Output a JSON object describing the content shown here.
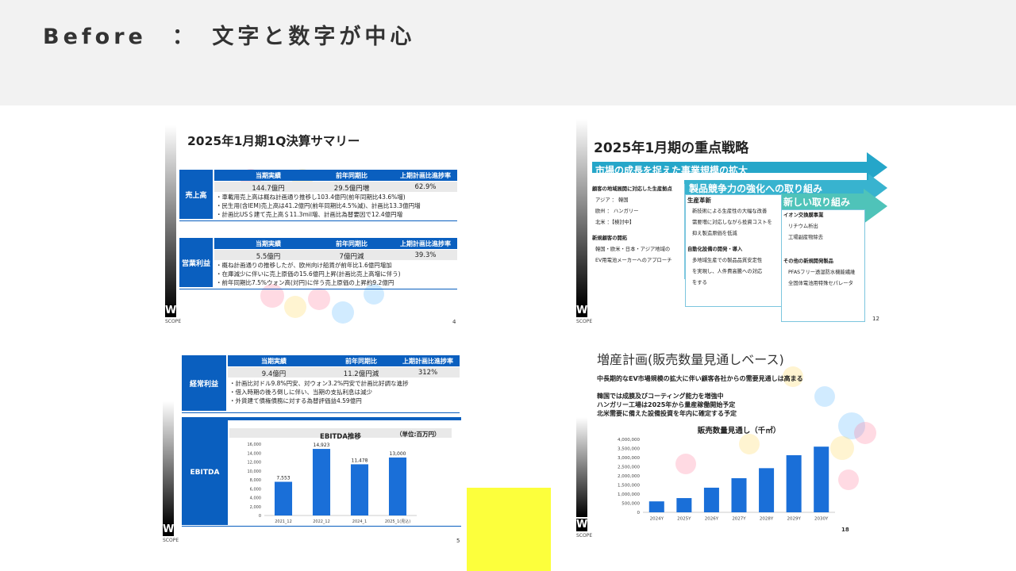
{
  "header": {
    "title": "Before　：　文字と数字が中心"
  },
  "slide_summary": {
    "title": "2025年1月期1Q決算サマリー",
    "page_number": "4",
    "logo_text": "SCOPE",
    "columns": [
      "当期実績",
      "前年同期比",
      "上期計画比進捗率"
    ],
    "sales": {
      "label": "売上高",
      "values": [
        "144.7億円",
        "29.5億円増",
        "62.9%"
      ],
      "bullets": [
        "・車載用売上高は概ね計画通り推移し103.4億円(前年同期比43.6%増)",
        "・民生用(含IEM)売上高は41.2億円(前年同期比4.5%減)、計画比13.3億円増",
        "・計画比US＄建て売上高＄11.3mil増、計画比為替要因で12.4億円増"
      ]
    },
    "op_profit": {
      "label": "営業利益",
      "values": [
        "5.5億円",
        "7億円減",
        "39.3%"
      ],
      "bullets": [
        "・概ね計画通りの推移したが、欧州向け船賃が前年比1.6億円増加",
        "・在庫減少に伴いに売上原価の15.6億円上昇(計画比売上高増に伴う)",
        "・前年同期比7.5%ウォン高(対円)に伴う売上原価の上昇約9.2億円"
      ]
    }
  },
  "slide_strategy": {
    "title": "2025年1月期の重点戦略",
    "page_number": "12",
    "logo_text": "SCOPE",
    "arrows": [
      "市場の成長を捉えた事業規模の拡大",
      "製品競争力の強化への取り組み",
      "新しい取り組み"
    ],
    "col1": {
      "heading1": "顧客の地域展開に対応した生産拠点",
      "lines1": [
        "アジア ： 韓国",
        "欧州 ： ハンガリー",
        "北米 ：【検討中】"
      ],
      "heading2": "新規顧客の開拓",
      "lines2": [
        "韓国・欧米・日本・アジア地域の",
        "EV用電池メーカーへのアプローチ"
      ]
    },
    "col2": {
      "heading1": "生産革新",
      "lines1": [
        "新技術による生産性の大幅な改善",
        "需要増に対応しながら投資コストを",
        "抑え製造原価を低減"
      ],
      "heading2": "自動化設備の開発・導入",
      "lines2": [
        "多地域生産での製品品質安定性",
        "を実現し、人件費高騰への対応",
        "をする"
      ]
    },
    "col3": {
      "heading1": "イオン交換膜事業",
      "lines1": [
        "リチウム析出",
        "工場副産物除去"
      ],
      "heading2": "その他の新規開発製品",
      "lines2": [
        "PFASフリー透湿防水機能繊維",
        "全固体電池用特殊セパレータ"
      ]
    }
  },
  "slide_ebitda": {
    "page_number": "5",
    "logo_text": "SCOPE",
    "columns": [
      "当期実績",
      "前年同期比",
      "上期計画比進捗率"
    ],
    "ordinary_profit": {
      "label": "経常利益",
      "values": [
        "9.4億円",
        "11.2億円減",
        "312%"
      ],
      "bullets": [
        "・計画比対ドル9.8%円安、対ウォン3.2%円安で計画比好調な進捗",
        "・借入時期の後ろ倒しに伴い、当期の支払利息は減少",
        "・外貨建て債権債務に対する為替評価益4.59億円"
      ]
    },
    "ebitda_label": "EBITDA",
    "unit": "（単位:百万円）"
  },
  "slide_production": {
    "title": "増産計画(販売数量見通しベース)",
    "page_number": "18",
    "logo_text": "SCOPE",
    "lines": [
      "中長期的なEV市場規模の拡大に伴い顧客各社からの需要見通しは高まる",
      "韓国では成膜及びコーティング能力を増強中",
      "ハンガリー工場は2025年から量産稼働開始予定",
      "北米需要に備えた設備投資を年内に確定する予定"
    ]
  },
  "chart_data": [
    {
      "type": "bar",
      "title": "EBITDA推移",
      "categories": [
        "2021_12",
        "2022_12",
        "2024_1",
        "2025_1(見込)"
      ],
      "values": [
        7553,
        14923,
        11478,
        13000
      ],
      "value_labels": [
        "7,553",
        "14,923",
        "11,478",
        "13,000"
      ],
      "yticks": [
        "0",
        "2,000",
        "4,000",
        "6,000",
        "8,000",
        "10,000",
        "12,000",
        "14,000",
        "16,000"
      ],
      "ylim": [
        0,
        16000
      ],
      "color": "#1a6fd8"
    },
    {
      "type": "bar",
      "title": "販売数量見通し（千㎡）",
      "categories": [
        "2024Y",
        "2025Y",
        "2026Y",
        "2027Y",
        "2028Y",
        "2029Y",
        "2030Y"
      ],
      "values": [
        600000,
        780000,
        1350000,
        1870000,
        2420000,
        3130000,
        3600000
      ],
      "yticks": [
        "0",
        "500,000",
        "1,000,000",
        "1,500,000",
        "2,000,000",
        "2,500,000",
        "3,000,000",
        "3,500,000",
        "4,000,000"
      ],
      "ylim": [
        0,
        4000000
      ],
      "color": "#1a6fd8"
    }
  ]
}
